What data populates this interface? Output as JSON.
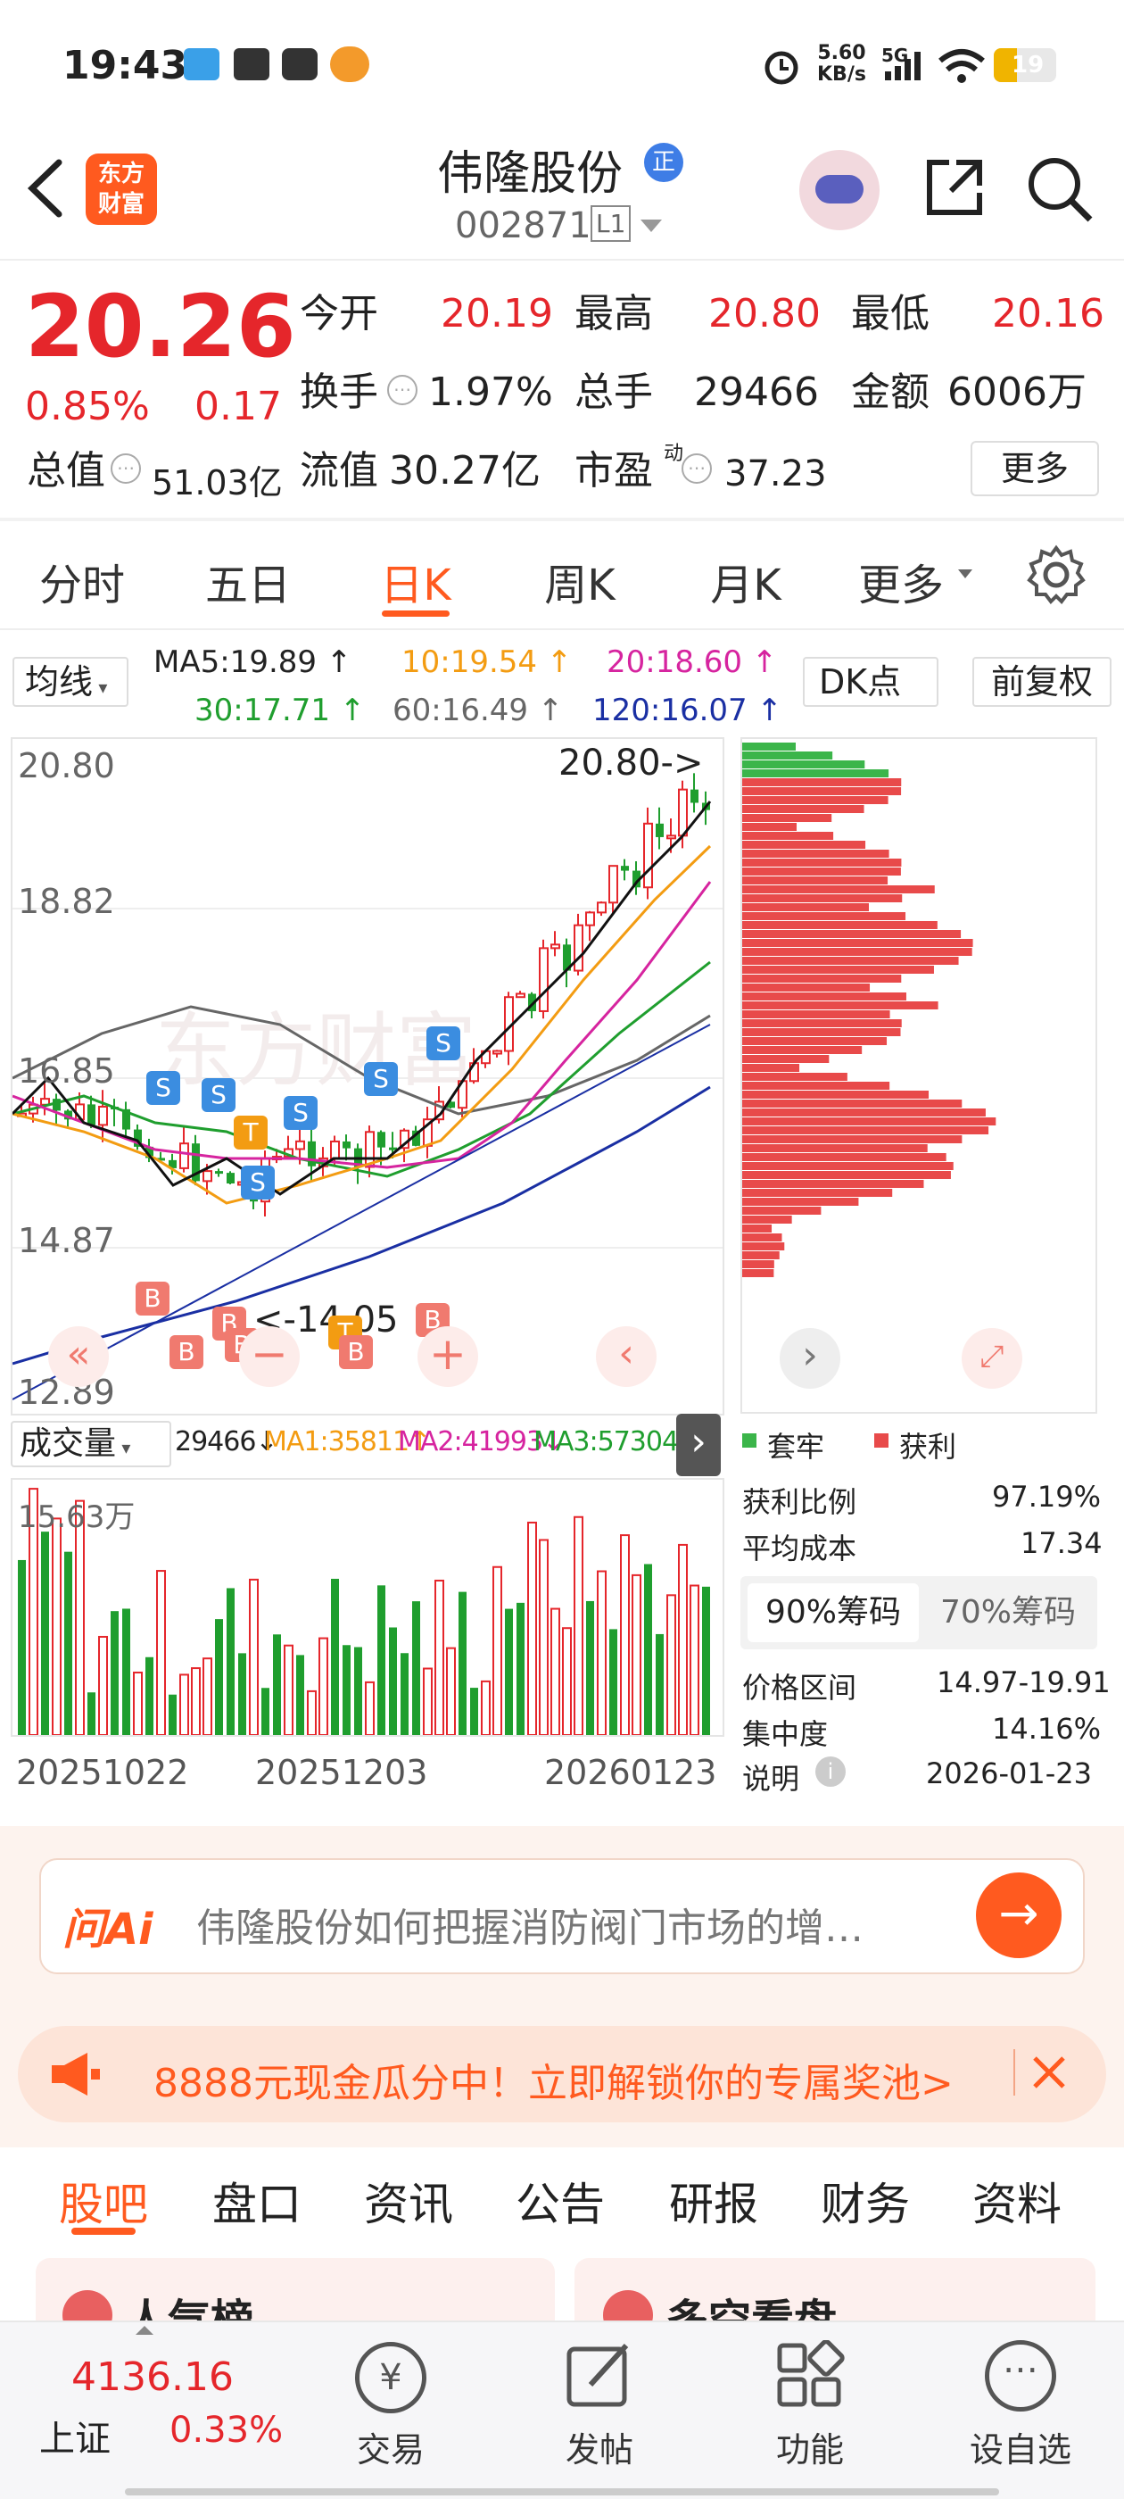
{
  "status": {
    "time": "19:43",
    "speed": "5.60",
    "speed_unit": "KB/s",
    "net": "5G",
    "battery": "19"
  },
  "header": {
    "logo_line1": "东方",
    "logo_line2": "财富",
    "name": "伟隆股份",
    "badge": "正",
    "code": "002871",
    "level": "L1"
  },
  "quote": {
    "price": "20.26",
    "pct": "0.85%",
    "chg": "0.17",
    "stats": [
      {
        "label": "今开",
        "value": "20.19"
      },
      {
        "label": "最高",
        "value": "20.80"
      },
      {
        "label": "最低",
        "value": "20.16"
      },
      {
        "label": "换手",
        "value": "1.97%"
      },
      {
        "label": "总手",
        "value": "29466"
      },
      {
        "label": "金额",
        "value": "6006万"
      },
      {
        "label": "总值",
        "value": "51.03亿"
      },
      {
        "label": "流值",
        "value": "30.27亿"
      },
      {
        "label": "市盈",
        "sup": "动",
        "value": "37.23"
      }
    ],
    "more": "更多"
  },
  "tabs": [
    "分时",
    "五日",
    "日K",
    "周K",
    "月K",
    "更多"
  ],
  "active_tab": 2,
  "ma": {
    "selector": "均线",
    "ma5": "MA5:19.89 ↑",
    "ma10": "10:19.54 ↑",
    "ma20": "20:18.60 ↑",
    "ma30": "30:17.71 ↑",
    "ma60": "60:16.49 ↑",
    "ma120": "120:16.07 ↑",
    "dk": "DK点",
    "fq": "前复权"
  },
  "kchart": {
    "y_labels": [
      "20.80",
      "18.82",
      "16.85",
      "14.87",
      "12.89"
    ],
    "high_label": "20.80->",
    "low_label": "<-14.05",
    "buy": "B",
    "sell": "S",
    "t": "T"
  },
  "volume": {
    "selector": "成交量",
    "vol": "29466↓",
    "ma1": "MA1:35811↑",
    "ma2": "MA2:41993↓",
    "ma3": "MA3:57304↓",
    "ymax": "15.63万",
    "dates": [
      "20251022",
      "20251203",
      "20260123"
    ]
  },
  "chip": {
    "legend_trapped": "套牢",
    "legend_profit": "获利",
    "rows": [
      {
        "label": "获利比例",
        "value": "97.19%"
      },
      {
        "label": "平均成本",
        "value": "17.34"
      }
    ],
    "tab1": "90%筹码",
    "tab2": "70%筹码",
    "rows2": [
      {
        "label": "价格区间",
        "value": "14.97-19.91"
      },
      {
        "label": "集中度",
        "value": "14.16%"
      },
      {
        "label": "说明",
        "value": "2026-01-23"
      }
    ]
  },
  "ai": {
    "logo": "问Ai",
    "text": "伟隆股份如何把握消防阀门市场的增…"
  },
  "promo": {
    "text": "8888元现金瓜分中！立即解锁你的专属奖池>"
  },
  "subtabs": [
    "股吧",
    "盘口",
    "资讯",
    "公告",
    "研报",
    "财务",
    "资料"
  ],
  "cards": [
    "人气榜",
    "多空看盘"
  ],
  "bottom": {
    "index_value": "4136.16",
    "index_name": "上证",
    "index_pct": "0.33%",
    "items": [
      "交易",
      "发帖",
      "功能",
      "设自选"
    ]
  },
  "colors": {
    "up": "#e5262b",
    "down": "#1f9e2e",
    "accent": "#ff6a00"
  }
}
